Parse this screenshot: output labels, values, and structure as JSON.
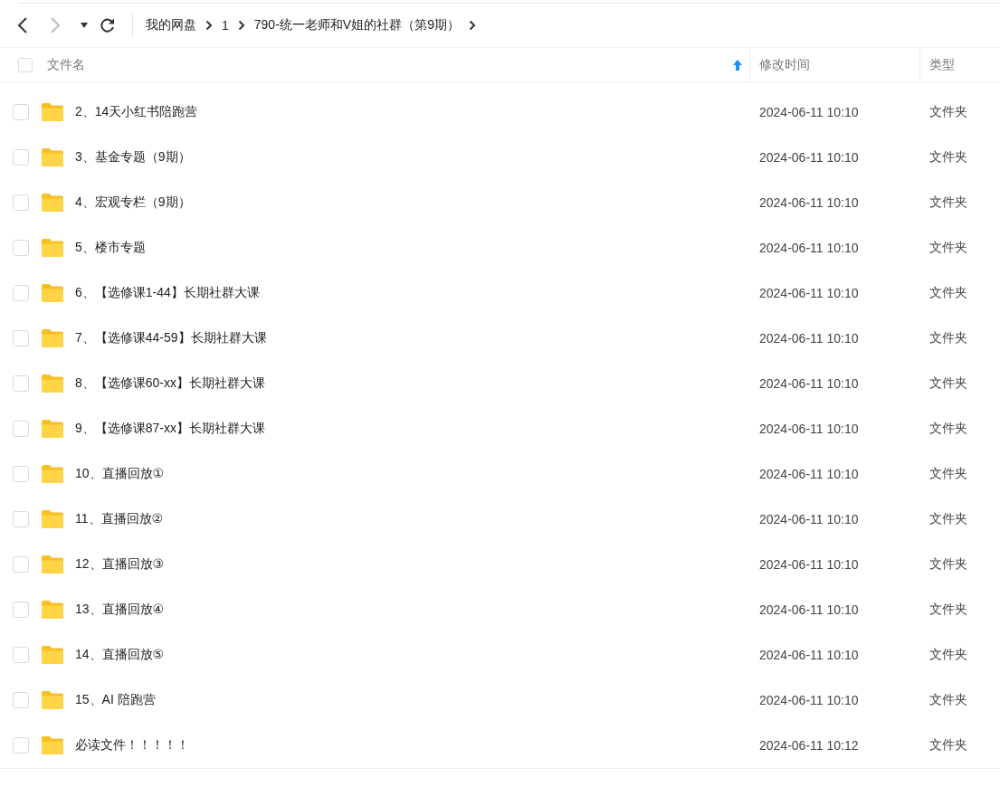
{
  "toolbar": {
    "back_disabled": false,
    "forward_disabled": true
  },
  "breadcrumb": [
    "我的网盘",
    "1",
    "790-统一老师和V姐的社群（第9期）"
  ],
  "table": {
    "columns": [
      {
        "label": "文件名",
        "sorted": true
      },
      {
        "label": "修改时间",
        "sorted": false
      },
      {
        "label": "类型",
        "sorted": false
      }
    ],
    "all_selected": false,
    "rows": [
      {
        "name": "2、14天小红书陪跑营",
        "modified": "2024-06-11 10:10",
        "type": "文件夹",
        "selected": false
      },
      {
        "name": "3、基金专题（9期）",
        "modified": "2024-06-11 10:10",
        "type": "文件夹",
        "selected": false
      },
      {
        "name": "4、宏观专栏（9期）",
        "modified": "2024-06-11 10:10",
        "type": "文件夹",
        "selected": false
      },
      {
        "name": "5、楼市专题",
        "modified": "2024-06-11 10:10",
        "type": "文件夹",
        "selected": false
      },
      {
        "name": "6、【选修课1-44】长期社群大课",
        "modified": "2024-06-11 10:10",
        "type": "文件夹",
        "selected": false
      },
      {
        "name": "7、【选修课44-59】长期社群大课",
        "modified": "2024-06-11 10:10",
        "type": "文件夹",
        "selected": false
      },
      {
        "name": "8、【选修课60-xx】长期社群大课",
        "modified": "2024-06-11 10:10",
        "type": "文件夹",
        "selected": false
      },
      {
        "name": "9、【选修课87-xx】长期社群大课",
        "modified": "2024-06-11 10:10",
        "type": "文件夹",
        "selected": false
      },
      {
        "name": "10、直播回放①",
        "modified": "2024-06-11 10:10",
        "type": "文件夹",
        "selected": false
      },
      {
        "name": "11、直播回放②",
        "modified": "2024-06-11 10:10",
        "type": "文件夹",
        "selected": false
      },
      {
        "name": "12、直播回放③",
        "modified": "2024-06-11 10:10",
        "type": "文件夹",
        "selected": false
      },
      {
        "name": "13、直播回放④",
        "modified": "2024-06-11 10:10",
        "type": "文件夹",
        "selected": false
      },
      {
        "name": "14、直播回放⑤",
        "modified": "2024-06-11 10:10",
        "type": "文件夹",
        "selected": false
      },
      {
        "name": "15、AI 陪跑营",
        "modified": "2024-06-11 10:10",
        "type": "文件夹",
        "selected": false
      },
      {
        "name": "必读文件！！！！！",
        "modified": "2024-06-11 10:12",
        "type": "文件夹",
        "selected": false
      }
    ]
  }
}
